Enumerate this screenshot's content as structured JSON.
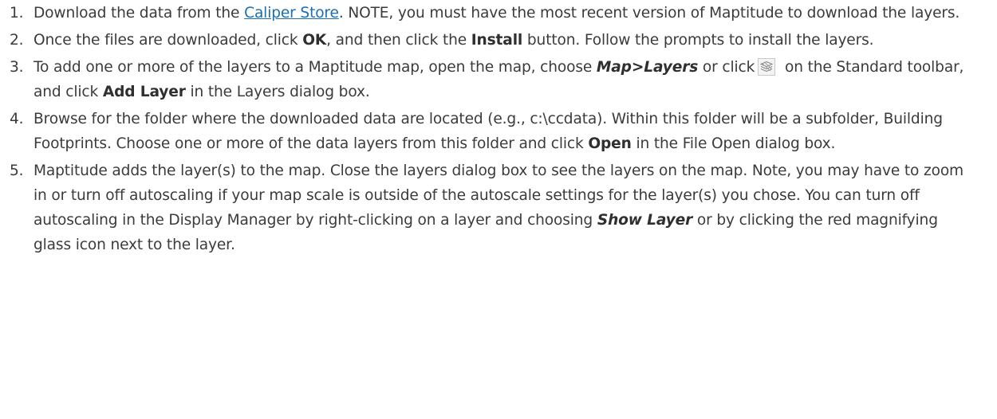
{
  "steps": [
    {
      "number": "1.",
      "text_before_link": "Download the data from the ",
      "link": "Caliper Store",
      "text_after_link": ". NOTE, you must have the most recent version of Maptitude to download the layers."
    },
    {
      "number": "2.",
      "t1": "Once the files are downloaded, click ",
      "b1": "OK",
      "t2": ", and then click the ",
      "b2": "Install",
      "t3": " button. Follow the prompts to install the layers."
    },
    {
      "number": "3.",
      "t1": "To add one or more of the layers to a Maptitude map, open the map, choose ",
      "bi1": "Map>Layers",
      "t2": " or click",
      "icon": "layers-icon",
      "t3": " on the Standard toolbar, and click ",
      "b1": "Add Layer",
      "t4": " in the Layers dialog box."
    },
    {
      "number": "4.",
      "t1": "Browse for the folder where the downloaded data are located (e.g., c:\\ccdata). Within this folder will be a subfolder, Building Footprints. Choose one or more of the data layers from this folder and click ",
      "b1": "Open",
      "t2": " in the File Open dialog box."
    },
    {
      "number": "5.",
      "t1": "Maptitude adds the layer(s) to the map. Close the layers dialog box to see the layers on the map. Note, you may have to zoom in or turn off autoscaling if your map scale is outside of the autoscale settings for the layer(s) you chose. You can turn off autoscaling in the Display Manager by right-clicking on a layer and choosing ",
      "bi1": "Show Layer",
      "t2": " or by clicking the red magnifying glass icon next to the layer."
    }
  ]
}
